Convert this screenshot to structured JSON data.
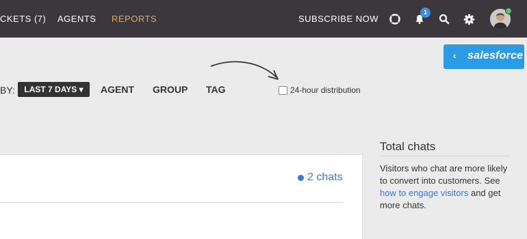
{
  "topbar": {
    "nav": [
      {
        "label": "CKETS (7)",
        "active": false
      },
      {
        "label": "AGENTS",
        "active": false
      },
      {
        "label": "REPORTS",
        "active": true
      }
    ],
    "subscribe_label": "SUBSCRIBE NOW",
    "notification_count": "1",
    "icons": [
      "lifebuoy-icon",
      "bell-icon",
      "search-icon",
      "gear-icon"
    ]
  },
  "salesforce": {
    "chevron": "‹",
    "label": "salesforce"
  },
  "filters": {
    "by_label": "BY:",
    "range_label": "LAST 7 DAYS ▾",
    "group_options": [
      "AGENT",
      "GROUP",
      "TAG"
    ],
    "distribution_label": "24-hour distribution",
    "distribution_checked": false
  },
  "chart": {
    "legend_label": "2 chats",
    "series_color": "#3b78d8"
  },
  "sidebar": {
    "title": "Total chats",
    "text_before": "Visitors who chat are more likely to convert into customers. See ",
    "link": "how to engage visitors",
    "text_after": " and get more chats."
  },
  "colors": {
    "topbar": "#3c373c",
    "accent": "#e8a84c",
    "salesforce": "#2c9be5",
    "link": "#3b78d8"
  }
}
